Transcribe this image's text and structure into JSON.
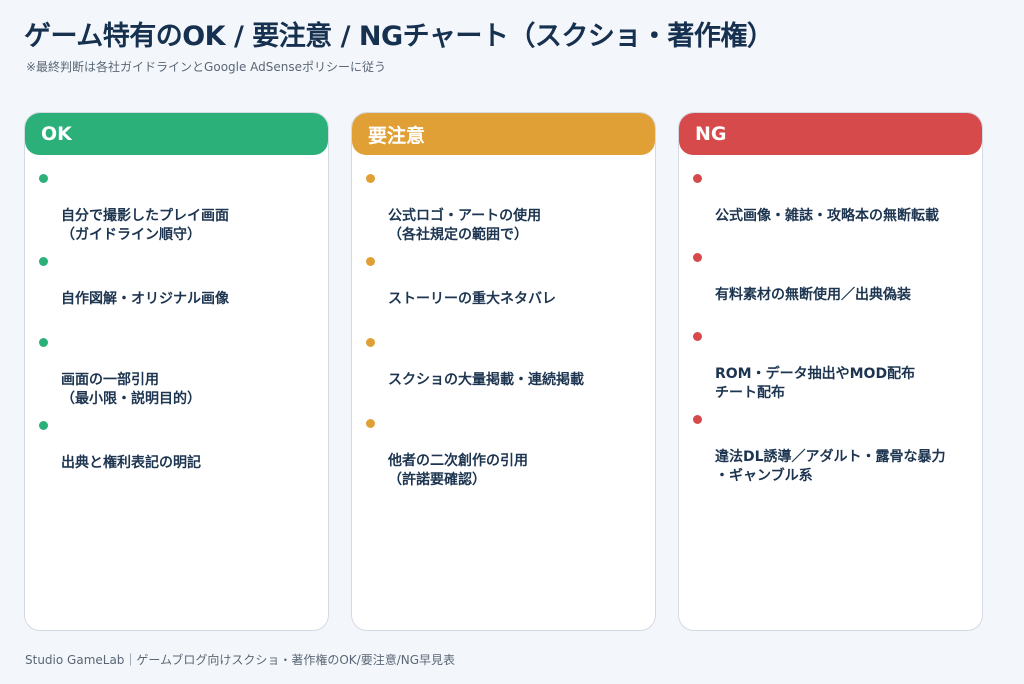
{
  "title": "ゲーム特有のOK / 要注意 / NGチャート（スクショ・著作権）",
  "subtitle": "※最終判断は各社ガイドラインとGoogle AdSenseポリシーに従う",
  "colors": {
    "ok": "#2bb07a",
    "caution": "#e0a035",
    "ng": "#d64a4b"
  },
  "columns": [
    {
      "heading": "OK",
      "items": [
        "自分で撮影したプレイ画面\n（ガイドライン順守）",
        "自作図解・オリジナル画像",
        "画面の一部引用\n（最小限・説明目的）",
        "出典と権利表記の明記"
      ]
    },
    {
      "heading": "要注意",
      "items": [
        "公式ロゴ・アートの使用\n（各社規定の範囲で）",
        "ストーリーの重大ネタバレ",
        "スクショの大量掲載・連続掲載",
        "他者の二次創作の引用\n（許諾要確認）"
      ]
    },
    {
      "heading": "NG",
      "items": [
        "公式画像・雑誌・攻略本の無断転載",
        "有料素材の無断使用／出典偽装",
        "ROM・データ抽出やMOD配布\nチート配布",
        "違法DL誘導／アダルト・露骨な暴力\n・ギャンブル系"
      ]
    }
  ],
  "footer": "Studio GameLab｜ゲームブログ向けスクショ・著作権のOK/要注意/NG早見表"
}
